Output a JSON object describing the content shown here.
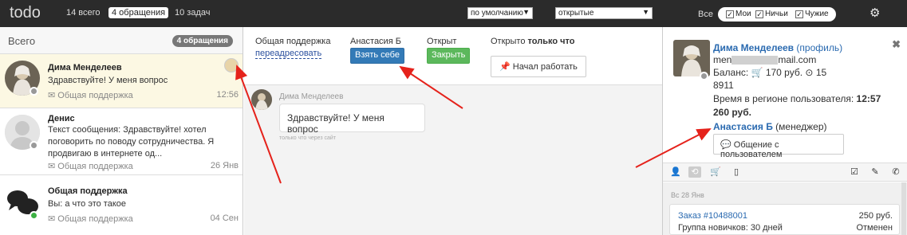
{
  "app": {
    "title": "todo"
  },
  "top_tabs": [
    {
      "label": "14 всего"
    },
    {
      "label": "4 обращения"
    },
    {
      "label": "10 задач"
    }
  ],
  "selects": {
    "sort": "по умолчанию",
    "status": "открытые"
  },
  "filters": {
    "all_label": "Все",
    "mine": "Мои",
    "nobody": "Ничьи",
    "others": "Чужие",
    "check": "✓"
  },
  "left": {
    "header": "Всего",
    "badge": "4 обращения",
    "conversations": [
      {
        "name": "Дима Менделеев",
        "text": "Здравствуйте! У меня вопрос",
        "dept": "Общая поддержка",
        "date": "12:56"
      },
      {
        "name": "Денис",
        "text": "Текст сообщения: Здравствуйте! хотел поговорить по поводу сотрудничества. Я продвигаю в интернете од...",
        "dept": "Общая поддержка",
        "date": "26 Янв"
      },
      {
        "name": "Общая поддержка",
        "text": "Вы: а что это такое",
        "dept": "Общая поддержка",
        "date": "04 Сен"
      }
    ]
  },
  "middle": {
    "dept_label": "Общая поддержка",
    "redirect_link": "переадресовать",
    "assignee_label": "Анастасия Б",
    "take_button": "Взять себе",
    "status_label": "Открыт",
    "close_button": "Закрыть",
    "opened_prefix": "Открыто",
    "opened_time": "только что",
    "start_button": "Начал работать",
    "message": {
      "author": "Дима Менделеев",
      "text": "Здравствуйте! У меня вопрос",
      "meta": "только что через сайт"
    }
  },
  "right": {
    "user_name": "Дима Менделеев",
    "profile_link": "(профиль)",
    "email_prefix": "men",
    "email_suffix": "mail.com",
    "balance_label": "Баланс:",
    "balance_value": "170 руб.",
    "balance_count": "15",
    "phone": "8911",
    "region_time_label": "Время в регионе пользователя:",
    "region_time": "12:57",
    "amount": "260 руб.",
    "manager_name": "Анастасия Б",
    "manager_role": "(менеджер)",
    "chat_button": "Общение с пользователем",
    "feed_date": "Вс 28 Янв",
    "order": {
      "link": "Заказ #10488001",
      "price": "250 руб.",
      "group": "Группа новичков: 30 дней",
      "status": "Отменен"
    }
  },
  "colors": {
    "topbar": "#2b2b2b",
    "selected_row": "#fcf8e3",
    "primary": "#337ab7",
    "success": "#5cb85c",
    "link": "#2a6ab0",
    "annotation": "#e5221b"
  }
}
